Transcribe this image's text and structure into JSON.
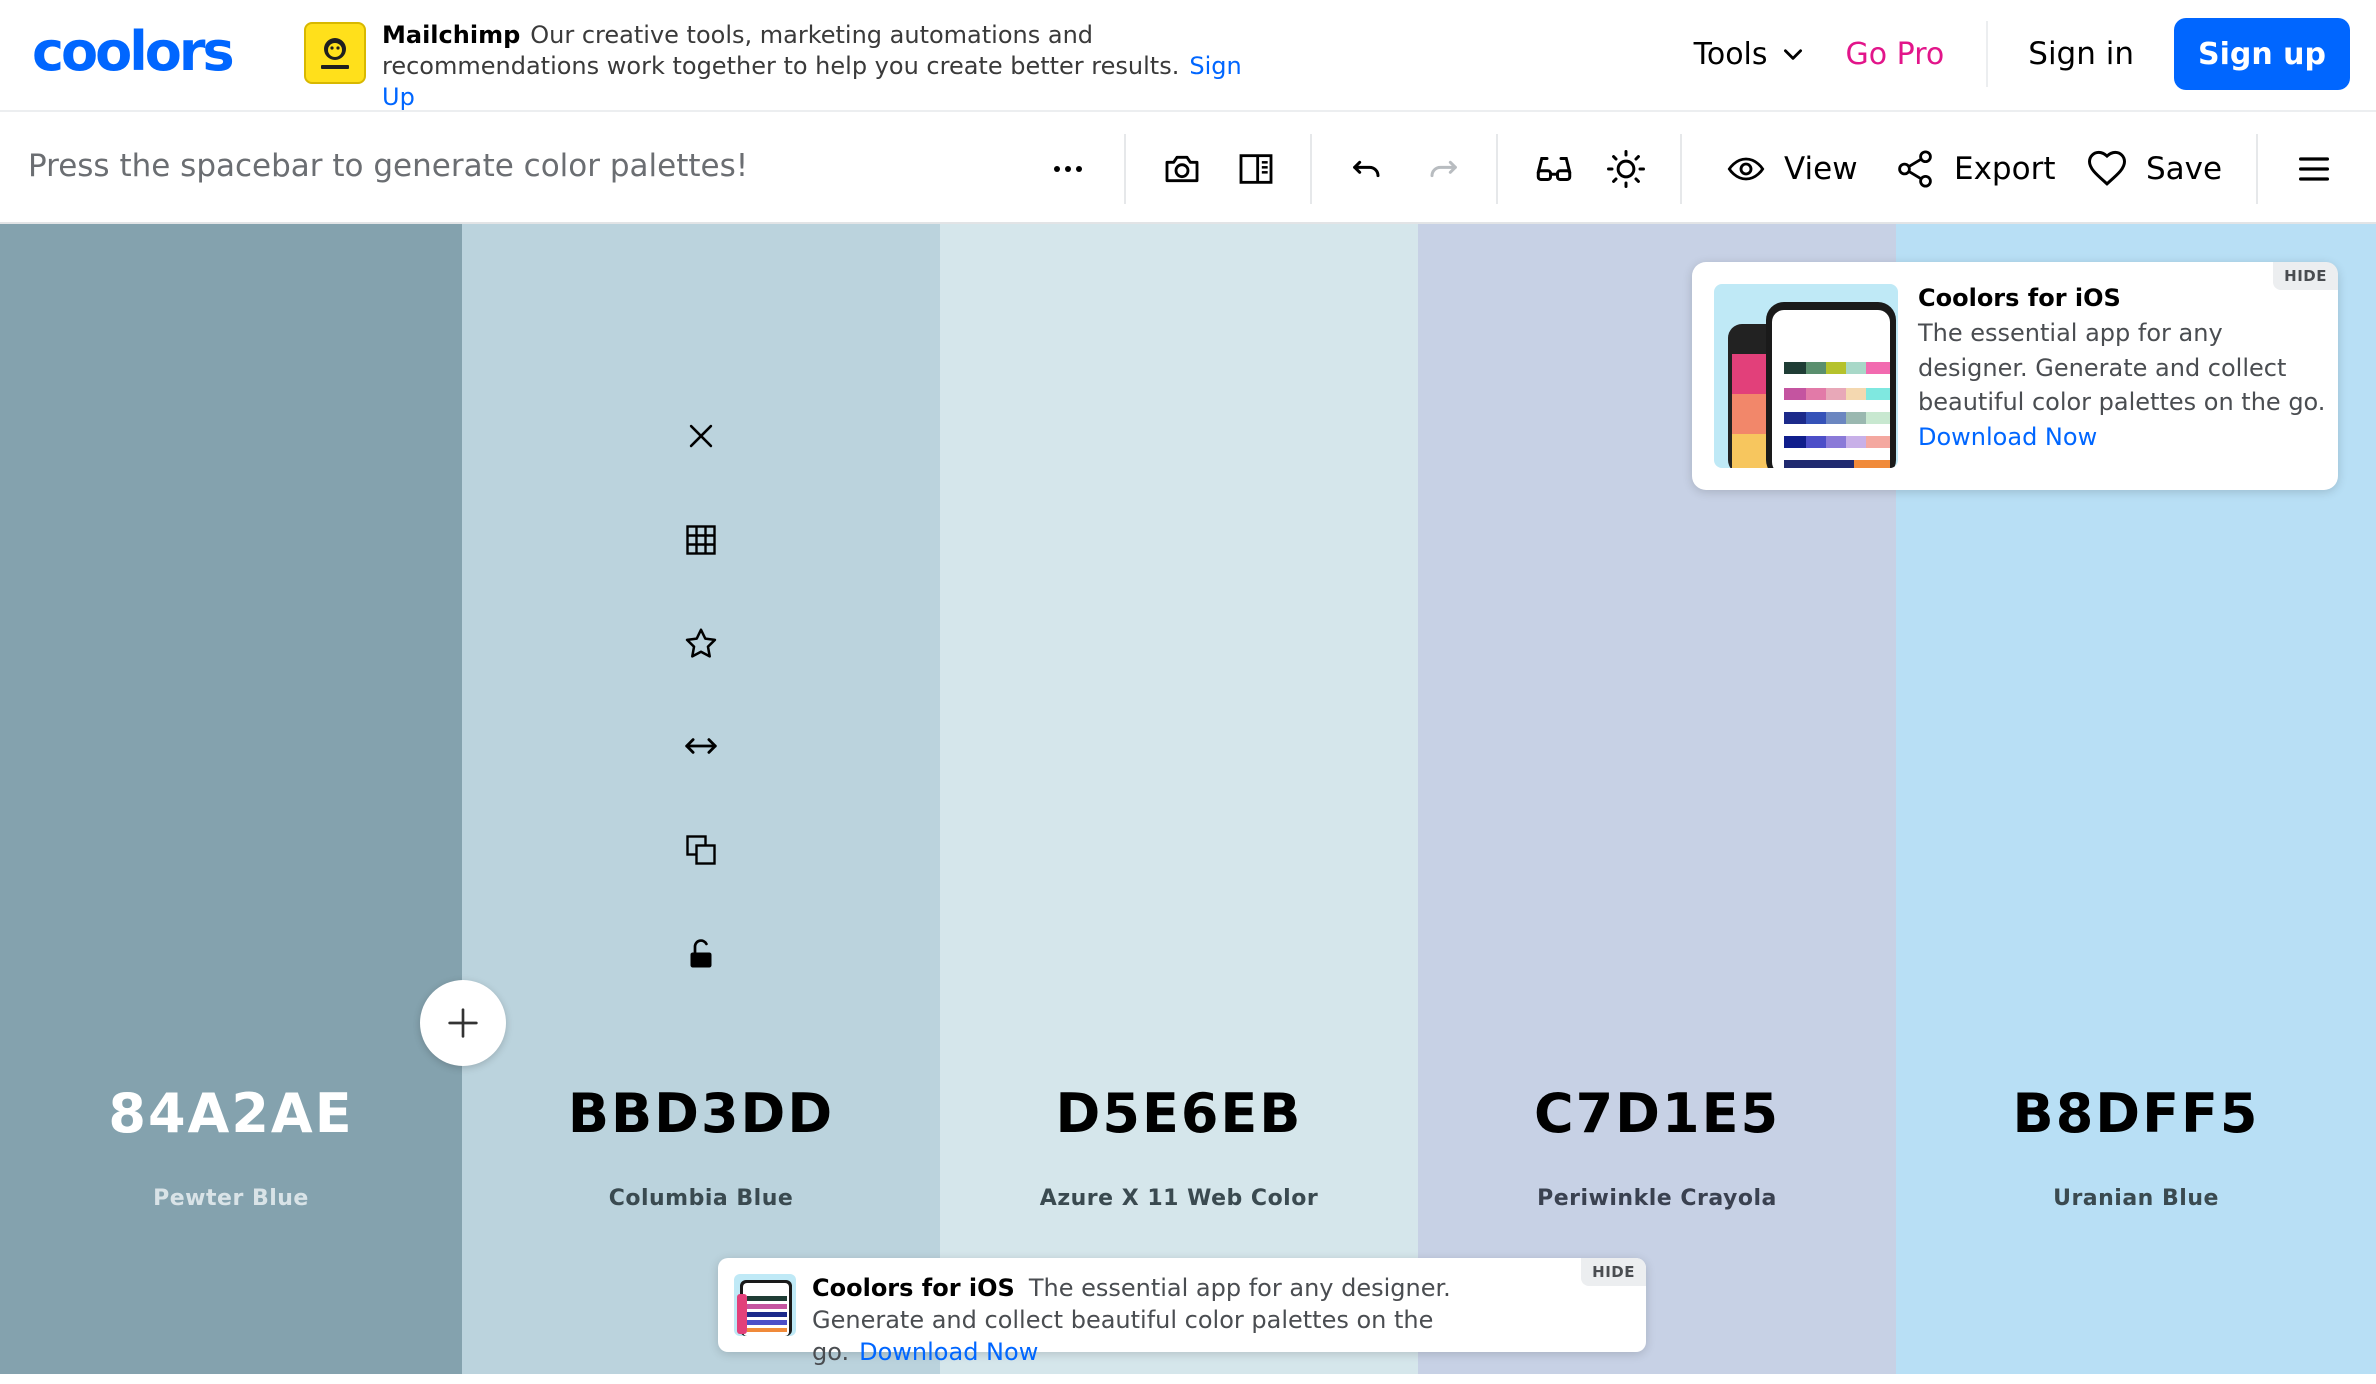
{
  "header": {
    "logo": "coolors",
    "ad": {
      "brand": "Mailchimp",
      "text": "Our creative tools, marketing automations and recommendations work together to help you create better results.",
      "link": "Sign Up"
    },
    "nav": {
      "tools": "Tools",
      "go_pro": "Go Pro",
      "sign_in": "Sign in",
      "sign_up": "Sign up"
    }
  },
  "toolbar": {
    "hint": "Press the spacebar to generate color palettes!",
    "view": "View",
    "export": "Export",
    "save": "Save"
  },
  "palette": [
    {
      "hex": "84A2AE",
      "name": "Pewter Blue",
      "bg": "#84a2ae",
      "text": "#ffffff",
      "subtext": "#d9e3e7"
    },
    {
      "hex": "BBD3DD",
      "name": "Columbia Blue",
      "bg": "#bbd3dd",
      "text": "#000000",
      "subtext": "#3a4a50"
    },
    {
      "hex": "D5E6EB",
      "name": "Azure X 11 Web Color",
      "bg": "#d5e6eb",
      "text": "#000000",
      "subtext": "#3a4a50"
    },
    {
      "hex": "C7D1E5",
      "name": "Periwinkle Crayola",
      "bg": "#c7d1e5",
      "text": "#000000",
      "subtext": "#3a4150"
    },
    {
      "hex": "B8DFF5",
      "name": "Uranian Blue",
      "bg": "#b8dff5",
      "text": "#000000",
      "subtext": "#3a4a50"
    }
  ],
  "ios_popup": {
    "title": "Coolors for iOS",
    "description": "The essential app for any designer. Generate and collect beautiful color palettes on the go.",
    "link": "Download Now",
    "hide": "HIDE"
  },
  "ios_banner": {
    "title": "Coolors for iOS",
    "description": "The essential app for any designer. Generate and collect beautiful color palettes on the go.",
    "link": "Download Now",
    "hide": "HIDE"
  },
  "icons": {
    "toolbar": [
      "more-icon",
      "camera-icon",
      "sidebar-panel-icon",
      "undo-icon",
      "redo-icon",
      "glasses-icon",
      "brightness-icon",
      "eye-icon",
      "share-icon",
      "heart-icon",
      "menu-icon"
    ],
    "column": [
      "close-icon",
      "grid-icon",
      "star-icon",
      "arrows-horizontal-icon",
      "copy-icon",
      "unlock-icon"
    ]
  }
}
